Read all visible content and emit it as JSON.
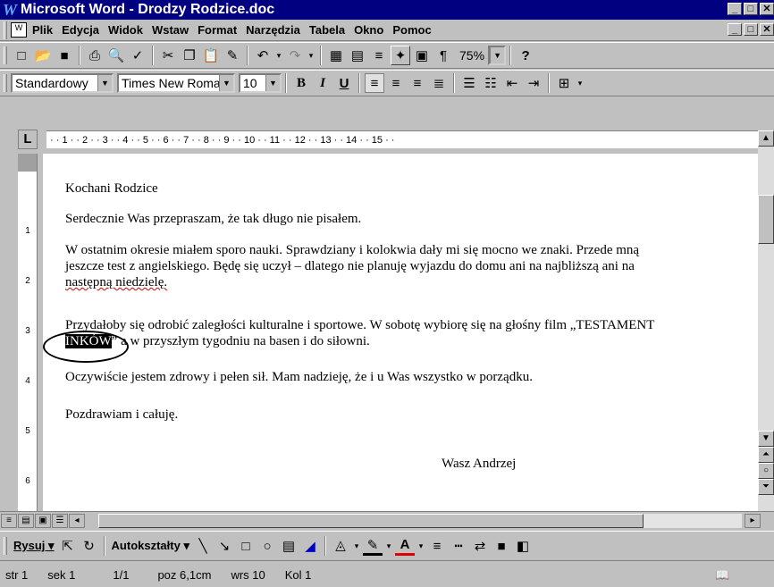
{
  "window": {
    "title": "Microsoft Word - Drodzy Rodzice.doc",
    "app_icon": "W",
    "buttons": [
      "_",
      "□",
      "✕"
    ]
  },
  "menubar": {
    "items": [
      "Plik",
      "Edycja",
      "Widok",
      "Wstaw",
      "Format",
      "Narzędzia",
      "Tabela",
      "Okno",
      "Pomoc"
    ]
  },
  "toolbar_standard": {
    "icons": [
      {
        "name": "new-document-icon",
        "glyph": "□"
      },
      {
        "name": "open-folder-icon",
        "glyph": "📂"
      },
      {
        "name": "save-icon",
        "glyph": "■"
      },
      {
        "name": "print-icon",
        "glyph": "⎙"
      },
      {
        "name": "print-preview-icon",
        "glyph": "🔍"
      },
      {
        "name": "spelling-icon",
        "glyph": "✓"
      },
      {
        "name": "cut-icon",
        "glyph": "✂"
      },
      {
        "name": "copy-icon",
        "glyph": "❐"
      },
      {
        "name": "paste-icon",
        "glyph": "📋"
      },
      {
        "name": "format-painter-icon",
        "glyph": "✎"
      },
      {
        "name": "undo-icon",
        "glyph": "↶"
      },
      {
        "name": "redo-icon",
        "glyph": "↷"
      },
      {
        "name": "table-icon",
        "glyph": "▦"
      },
      {
        "name": "excel-icon",
        "glyph": "▤"
      },
      {
        "name": "columns-icon",
        "glyph": "≡"
      },
      {
        "name": "drawing-icon",
        "glyph": "✦"
      },
      {
        "name": "doc-map-icon",
        "glyph": "▣"
      },
      {
        "name": "show-formatting-icon",
        "glyph": "¶"
      }
    ],
    "zoom": "75%",
    "help_icon": "?"
  },
  "toolbar_formatting": {
    "style": "Standardowy",
    "font": "Times New Roman",
    "size": "10",
    "bold": "B",
    "italic": "I",
    "underline": "U"
  },
  "ruler": {
    "horizontal": "· · 1 · · 2 · · 3 · · 4 · · 5 · · 6 · · 7 · · 8 · · 9 · · 10 · · 11 · · 12 · · 13 · · 14 · · 15 · ·",
    "vertical": [
      "1",
      "2",
      "3",
      "4",
      "5",
      "6",
      "7"
    ],
    "tab_selector": "L"
  },
  "document": {
    "greeting": "Kochani Rodzice",
    "p1": "Serdecznie Was przepraszam, że tak długo nie pisałem.",
    "p2_line1": "W ostatnim okresie miałem sporo nauki. Sprawdziany i kolokwia dały mi się mocno we znaki. Przede mną",
    "p2_line2": "jeszcze test z angielskiego. Będę się uczył – dlatego nie planuję wyjazdu do domu ani na najbliższą ani na",
    "p2_line3": "następną niedzielę.",
    "p3_line1": "Przydałoby się odrobić zaległości kulturalne i sportowe. W sobotę wybiorę się na głośny film „TESTAMENT",
    "p3_highlight": "INKÓW",
    "p3_line2_rest": "” a w przyszłym tygodniu na basen i do siłowni.",
    "p4": "Oczywiście jestem zdrowy i pełen sił. Mam nadzieję, że i u Was wszystko w porządku.",
    "p5": "Pozdrawiam i całuję.",
    "signature": "Wasz Andrzej"
  },
  "drawing_toolbar": {
    "draw": "Rysuj",
    "autoshapes": "Autokształty"
  },
  "status_bar": {
    "page": "str 1",
    "section": "sek 1",
    "pages": "1/1",
    "position": "poz 6,1cm",
    "line": "wrs 10",
    "column": "Kol 1"
  }
}
